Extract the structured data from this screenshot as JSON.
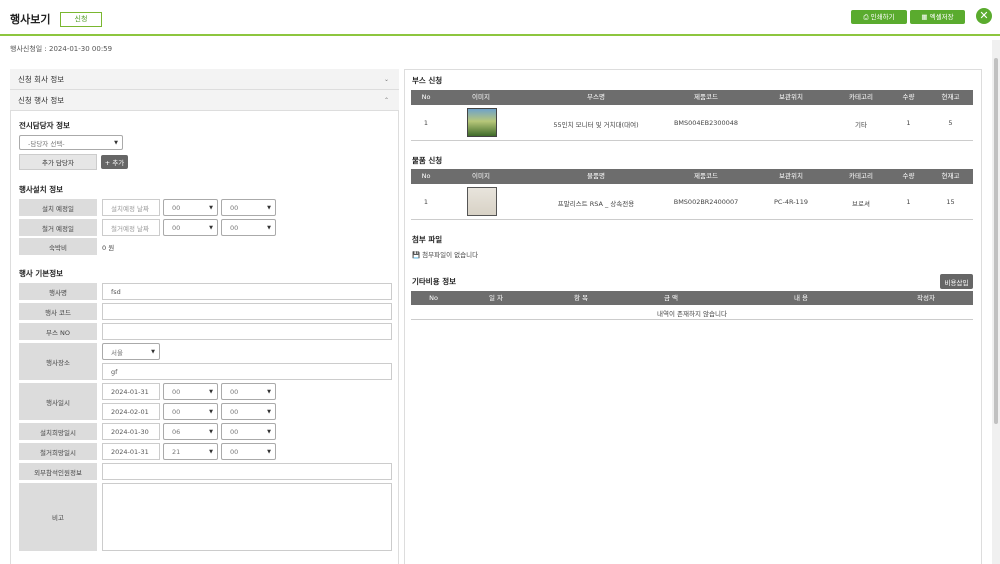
{
  "header": {
    "title": "행사보기",
    "badge": "신청",
    "print_label": "인쇄하기",
    "excel_label": "엑셀저장"
  },
  "meta": {
    "applied_at": "행사신청일 : 2024-01-30 00:59"
  },
  "accordions": {
    "company": "신청 회사 정보",
    "event": "신청 행사 정보"
  },
  "manager": {
    "section": "전시담당자 정보",
    "select": "-담당자 선택-",
    "add_manager": "추가 담당자",
    "add_button": "+ 추가"
  },
  "install": {
    "section": "행사설치 정보",
    "rows": [
      {
        "label": "설치 예정일",
        "date_placeholder": "설치예정 날짜",
        "hour": "00",
        "minute": "00"
      },
      {
        "label": "철거 예정일",
        "date_placeholder": "철거예정 날짜",
        "hour": "00",
        "minute": "00"
      }
    ],
    "lodging_label": "숙박비",
    "lodging_value": "0 원"
  },
  "basic": {
    "section": "행사 기본정보",
    "name_label": "행사명",
    "name_value": "fsd",
    "code_label": "행사 코드",
    "code_value": "",
    "booth_label": "부스 NO",
    "booth_value": "",
    "place_label": "행사장소",
    "place_region": "서울",
    "place_detail": "gf",
    "datetime_label": "행사일시",
    "start_date": "2024-01-31",
    "start_hour": "00",
    "start_minute": "00",
    "end_date": "2024-02-01",
    "end_hour": "00",
    "end_minute": "00",
    "install_label": "설치희망일시",
    "install_date": "2024-01-30",
    "install_hour": "06",
    "install_minute": "00",
    "remove_label": "철거희망일시",
    "remove_date": "2024-01-31",
    "remove_hour": "21",
    "remove_minute": "00",
    "external_label": "외부참석인원정보",
    "external_value": "",
    "note_label": "비고",
    "note_value": ""
  },
  "booth": {
    "section": "부스 신청",
    "headers": [
      "No",
      "이미지",
      "부스명",
      "제품코드",
      "보관위치",
      "카테고리",
      "수량",
      "현재고"
    ],
    "rows": [
      {
        "no": "1",
        "name": "55인치 모니터 및 거치대(대여)",
        "code": "BMS004EB2300048",
        "location": "",
        "category": "기타",
        "qty": "1",
        "stock": "5"
      }
    ]
  },
  "goods": {
    "section": "물품 신청",
    "headers": [
      "No",
      "이미지",
      "물품명",
      "제품코드",
      "보관위치",
      "카테고리",
      "수량",
      "현재고"
    ],
    "rows": [
      {
        "no": "1",
        "name": "프말리스트 RSA _ 상속전용",
        "code": "BMS002BR2400007",
        "location": "PC-4R-119",
        "category": "브로셔",
        "qty": "1",
        "stock": "15"
      }
    ]
  },
  "attach": {
    "section": "첨부 파일",
    "empty": "첨부파일이 없습니다"
  },
  "costs": {
    "section": "기타비용 정보",
    "insert_button": "비용삽입",
    "headers": [
      "No",
      "일 자",
      "항 목",
      "금 액",
      "내 용",
      "작성자"
    ],
    "empty": "내역이 존재하지 않습니다"
  },
  "colors": {
    "accent": "#5aab2e",
    "header_line": "#8dc63f",
    "table_head": "#6d6d6d"
  },
  "icons": {
    "print": "printer-icon",
    "excel": "excel-icon",
    "close": "close-icon",
    "file": "file-icon"
  }
}
